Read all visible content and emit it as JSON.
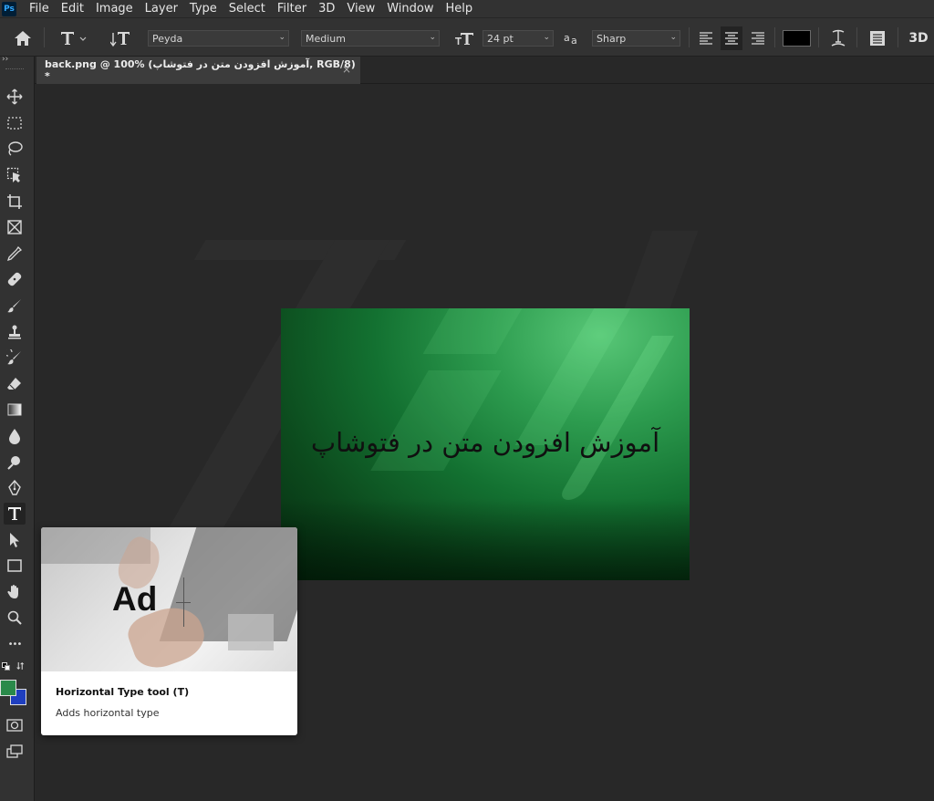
{
  "menubar": {
    "logo": "Ps",
    "items": [
      "File",
      "Edit",
      "Image",
      "Layer",
      "Type",
      "Select",
      "Filter",
      "3D",
      "View",
      "Window",
      "Help"
    ]
  },
  "options": {
    "font_family": "Peyda",
    "font_style": "Medium",
    "font_size": "24 pt",
    "antialias": "Sharp",
    "text_color": "#000000",
    "three_d_label": "3D"
  },
  "document": {
    "tab_title": "back.png @ 100% (آموزش افزودن متن در فتوشاپ, RGB/8) *",
    "close_glyph": "×",
    "image_text": "آموزش افزودن متن در فتوشاپ"
  },
  "tooltip": {
    "preview_text": "Ad",
    "title": "Horizontal Type tool (T)",
    "description": "Adds horizontal type"
  },
  "toolbar": {
    "expand_glyph": "››",
    "more_glyph": "•••",
    "foreground_color": "#2a8a4a",
    "background_color": "#1f3fbf"
  },
  "colors": {
    "accent": "#31a8ff",
    "ui_bg": "#323232",
    "canvas_bg": "#282828"
  }
}
